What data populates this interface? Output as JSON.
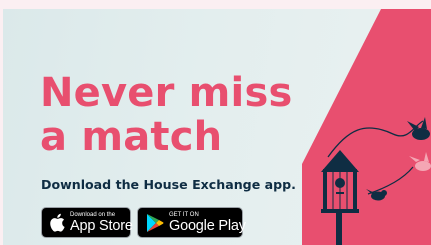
{
  "headline": {
    "line1": "Never miss",
    "line2": "a match"
  },
  "subtext": "Download the House Exchange app.",
  "app_store": {
    "small_text": "Download on the",
    "big_text": "App Store",
    "icon": "apple-icon"
  },
  "google_play": {
    "small_text": "GET IT ON",
    "big_text": "Google Play",
    "icon": "google-play-icon"
  },
  "colors": {
    "accent": "#e84f6f",
    "text_dark": "#0f2d43",
    "background": "#dbe9ea",
    "page_background": "#fbeff2"
  }
}
